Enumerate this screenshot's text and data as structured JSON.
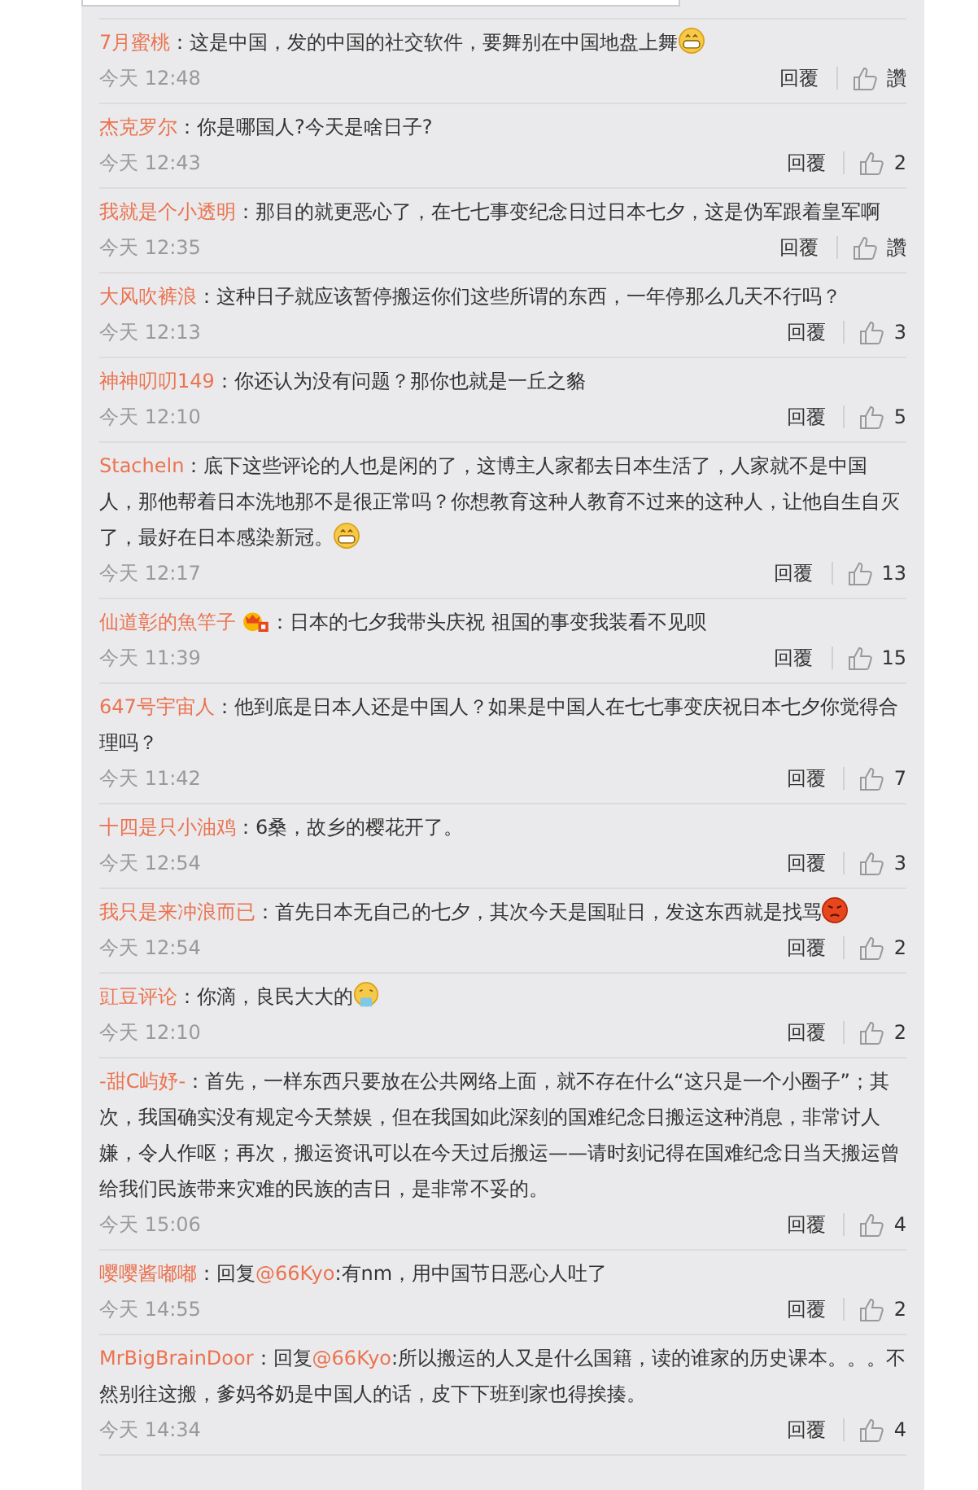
{
  "comments": [
    {
      "name": "7月蜜桃",
      "name_badge": false,
      "text": "：这是中国，发的中国的社交软件，要舞别在中国地盘上舞",
      "emoji": {
        "kind": "grin"
      },
      "time": "今天 12:48",
      "reply_label": "回覆",
      "likes": "讚"
    },
    {
      "name": "杰克罗尔",
      "name_badge": false,
      "text": "：你是哪国人?今天是啥日子?",
      "time": "今天 12:43",
      "reply_label": "回覆",
      "likes": "2"
    },
    {
      "name": "我就是个小透明",
      "name_badge": false,
      "text": "：那目的就更恶心了，在七七事变纪念日过日本七夕，这是伪军跟着皇军啊",
      "time": "今天 12:35",
      "reply_label": "回覆",
      "likes": "讚"
    },
    {
      "name": "大风吹裤浪",
      "name_badge": false,
      "text": "：这种日子就应该暂停搬运你们这些所谓的东西，一年停那么几天不行吗？",
      "time": "今天 12:13",
      "reply_label": "回覆",
      "likes": "3"
    },
    {
      "name": "神神叨叨149",
      "name_badge": false,
      "text": "：你还认为没有问题？那你也就是一丘之貉",
      "time": "今天 12:10",
      "reply_label": "回覆",
      "likes": "5"
    },
    {
      "name": "Stacheln",
      "name_badge": false,
      "text": "：底下这些评论的人也是闲的了，这博主人家都去日本生活了，人家就不是中国人，那他帮着日本洗地那不是很正常吗？你想教育这种人教育不过来的这种人，让他自生自灭了，最好在日本感染新冠。",
      "emoji": {
        "kind": "grin"
      },
      "time": "今天 12:17",
      "reply_label": "回覆",
      "likes": "13"
    },
    {
      "name": "仙道彰的魚竿子",
      "name_badge": true,
      "text": "：日本的七夕我带头庆祝 祖国的事变我装看不见呗",
      "time": "今天 11:39",
      "reply_label": "回覆",
      "likes": "15"
    },
    {
      "name": "647号宇宙人",
      "name_badge": false,
      "text": "：他到底是日本人还是中国人？如果是中国人在七七事变庆祝日本七夕你觉得合理吗？",
      "time": "今天 11:42",
      "reply_label": "回覆",
      "likes": "7"
    },
    {
      "name": "十四是只小油鸡",
      "name_badge": false,
      "text": "：6桑，故乡的樱花开了。",
      "time": "今天 12:54",
      "reply_label": "回覆",
      "likes": "3"
    },
    {
      "name": "我只是来冲浪而已",
      "name_badge": false,
      "text": "：首先日本无自己的七夕，其次今天是国耻日，发这东西就是找骂",
      "emoji": {
        "kind": "angry"
      },
      "time": "今天 12:54",
      "reply_label": "回覆",
      "likes": "2"
    },
    {
      "name": "豇豆评论",
      "name_badge": false,
      "text": "：你滴，良民大大的",
      "emoji": {
        "kind": "vomit"
      },
      "time": "今天 12:10",
      "reply_label": "回覆",
      "likes": "2"
    },
    {
      "name": "-甜C屿妤-",
      "name_badge": false,
      "text": "：首先，一样东西只要放在公共网络上面，就不存在什么“这只是一个小圈子”；其次，我国确实没有规定今天禁娱，但在我国如此深刻的国难纪念日搬运这种消息，非常讨人嫌，令人作呕；再次，搬运资讯可以在今天过后搬运——请时刻记得在国难纪念日当天搬运曾给我们民族带来灾难的民族的吉日，是非常不妥的。",
      "time": "今天 15:06",
      "reply_label": "回覆",
      "likes": "4"
    },
    {
      "name": "嘤嘤酱嘟嘟",
      "name_badge": false,
      "reply_prefix": "：回复",
      "mention": "@66Kyo",
      "text": ":有nm，用中国节日恶心人吐了",
      "time": "今天 14:55",
      "reply_label": "回覆",
      "likes": "2"
    },
    {
      "name": "MrBigBrainDoor",
      "name_badge": false,
      "reply_prefix": "：回复",
      "mention": "@66Kyo",
      "text": ":所以搬运的人又是什么国籍，读的谁家的历史课本。。。不然别往这搬，爹妈爷奶是中国人的话，皮下下班到家也得挨揍。",
      "time": "今天 14:34",
      "reply_label": "回覆",
      "likes": "4"
    }
  ]
}
